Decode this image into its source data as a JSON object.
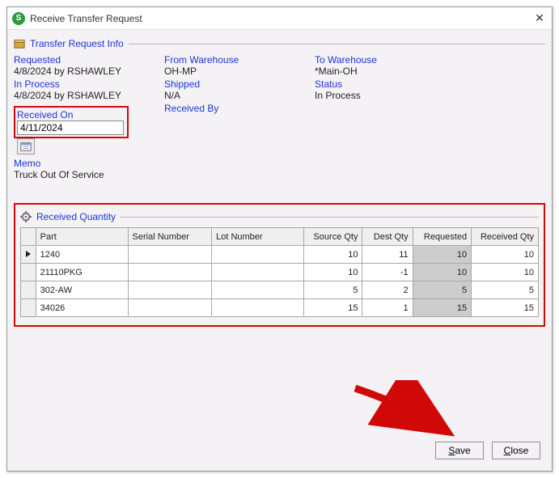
{
  "window": {
    "title": "Receive Transfer Request"
  },
  "section_info": {
    "title": "Transfer Request Info"
  },
  "info": {
    "requested_label": "Requested",
    "requested_value": "4/8/2024 by RSHAWLEY",
    "from_wh_label": "From Warehouse",
    "from_wh_value": "OH-MP",
    "to_wh_label": "To Warehouse",
    "to_wh_value": "*Main-OH",
    "inprocess_label": "In Process",
    "inprocess_value": "4/8/2024 by RSHAWLEY",
    "shipped_label": "Shipped",
    "shipped_value": "N/A",
    "status_label": "Status",
    "status_value": "In Process",
    "received_on_label": "Received On",
    "received_on_value": "4/11/2024",
    "received_by_label": "Received By",
    "memo_label": "Memo",
    "memo_value": "Truck Out Of Service"
  },
  "section_qty": {
    "title": "Received Quantity"
  },
  "grid": {
    "headers": {
      "part": "Part",
      "serial": "Serial Number",
      "lot": "Lot Number",
      "source": "Source Qty",
      "dest": "Dest Qty",
      "requested": "Requested",
      "received": "Received Qty"
    },
    "rows": [
      {
        "part": "1240",
        "serial": "",
        "lot": "",
        "source": "10",
        "dest": "11",
        "requested": "10",
        "received": "10"
      },
      {
        "part": "21110PKG",
        "serial": "",
        "lot": "",
        "source": "10",
        "dest": "-1",
        "requested": "10",
        "received": "10"
      },
      {
        "part": "302-AW",
        "serial": "",
        "lot": "",
        "source": "5",
        "dest": "2",
        "requested": "5",
        "received": "5"
      },
      {
        "part": "34026",
        "serial": "",
        "lot": "",
        "source": "15",
        "dest": "1",
        "requested": "15",
        "received": "15"
      }
    ]
  },
  "buttons": {
    "save": "Save",
    "close": "Close"
  }
}
